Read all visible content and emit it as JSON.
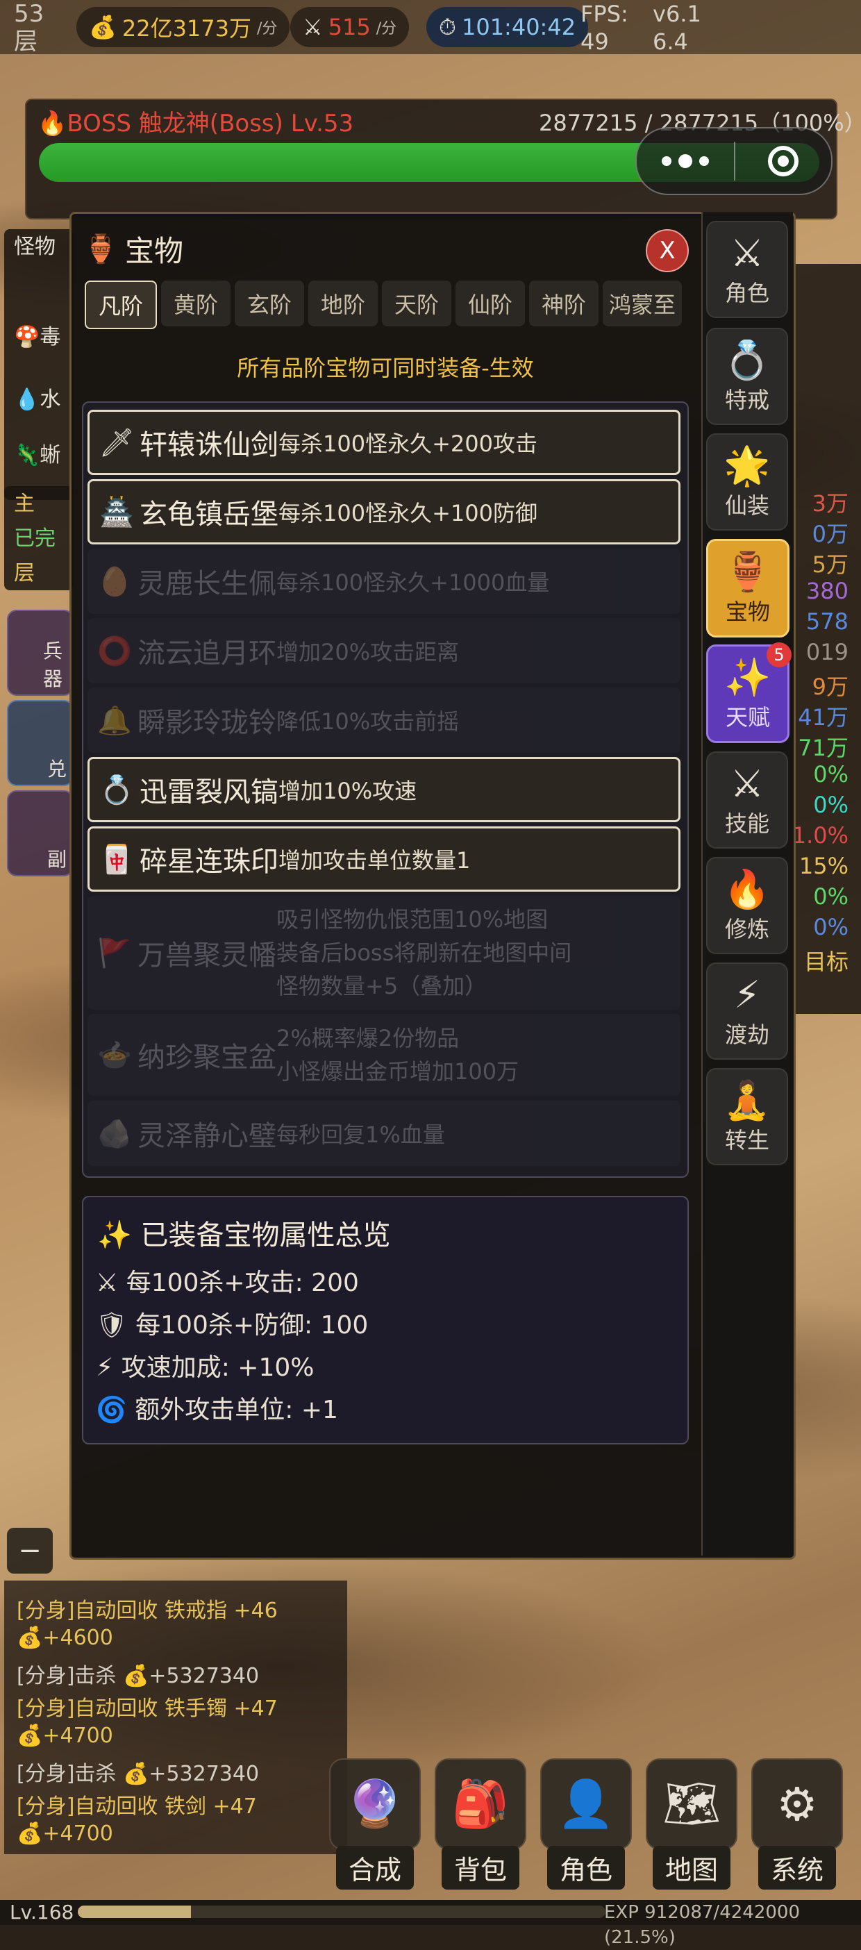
{
  "topbar": {
    "floor": "53\n层",
    "gold": "22亿3173万",
    "gold_unit": "/分",
    "kills": "515",
    "kills_unit": "/分",
    "timer": "101:40:42",
    "fps": "FPS: 49",
    "version": "v6.16.4"
  },
  "boss": {
    "name": "BOSS 触龙神(Boss) Lv.53",
    "hp": "2877215 / 2877215（100%）",
    "hp_fraction": 1.0
  },
  "left_panel": {
    "title": "怪物",
    "items": [
      "毒",
      "水",
      "蜥"
    ],
    "quest": "主",
    "quest_done": "已完",
    "quest_floor": "层",
    "btn1": "兵器",
    "btn2": "兑",
    "btn3": "副"
  },
  "right_values": [
    "3万",
    "0万",
    "5万",
    "380",
    "578",
    "019",
    "9万",
    "41万",
    "71万",
    "0%",
    "0%",
    "1.0%",
    "15%",
    "0%",
    "0%",
    "目标"
  ],
  "modal": {
    "title": "宝物",
    "close": "X",
    "tabs": [
      "凡阶",
      "黄阶",
      "玄阶",
      "地阶",
      "天阶",
      "仙阶",
      "神阶",
      "鸿蒙至"
    ],
    "active_tab": "凡阶",
    "notice": "所有品阶宝物可同时装备-生效",
    "treasures": [
      {
        "name": "轩辕诛仙剑",
        "desc": "每杀100怪永久+200攻击",
        "equipped": true
      },
      {
        "name": "玄龟镇岳堡",
        "desc": "每杀100怪永久+100防御",
        "equipped": true
      },
      {
        "name": "灵鹿长生佩",
        "desc": "每杀100怪永久+1000血量",
        "equipped": false
      },
      {
        "name": "流云追月环",
        "desc": "增加20%攻击距离",
        "equipped": false
      },
      {
        "name": "瞬影玲珑铃",
        "desc": "降低10%攻击前摇",
        "equipped": false
      },
      {
        "name": "迅雷裂风镐",
        "desc": "增加10%攻速",
        "equipped": true
      },
      {
        "name": "碎星连珠印",
        "desc": "增加攻击单位数量1",
        "equipped": true
      },
      {
        "name": "万兽聚灵幡",
        "desc": "吸引怪物仇恨范围10%地图\n装备后boss将刷新在地图中间\n怪物数量+5（叠加）",
        "equipped": false
      },
      {
        "name": "纳珍聚宝盆",
        "desc": "2%概率爆2份物品\n小怪爆出金币增加100万",
        "equipped": false
      },
      {
        "name": "灵泽静心璧",
        "desc": "每秒回复1%血量",
        "equipped": false
      }
    ],
    "summary": {
      "title": "已装备宝物属性总览",
      "lines": [
        "每100杀+攻击: 200",
        "每100杀+防御: 100",
        "攻速加成: +10%",
        "额外攻击单位: +1"
      ]
    }
  },
  "sidenav": [
    {
      "label": "角色",
      "icon": "⚔"
    },
    {
      "label": "特戒",
      "icon": "💍"
    },
    {
      "label": "仙装",
      "icon": "🌟"
    },
    {
      "label": "宝物",
      "icon": "🏺"
    },
    {
      "label": "天赋",
      "icon": "✨",
      "badge": "5"
    },
    {
      "label": "技能",
      "icon": "⚔"
    },
    {
      "label": "修炼",
      "icon": "🔥"
    },
    {
      "label": "渡劫",
      "icon": "⚡"
    },
    {
      "label": "转生",
      "icon": "🧘"
    }
  ],
  "log": [
    {
      "text": "[分身]自动回收 铁戒指 +46",
      "style": "y"
    },
    {
      "text": "💰+4600",
      "style": "y"
    },
    {
      "text": "[分身]击杀 💰+5327340",
      "style": "g"
    },
    {
      "text": "[分身]自动回收 铁手镯 +47",
      "style": "y"
    },
    {
      "text": "💰+4700",
      "style": "y"
    },
    {
      "text": "[分身]击杀 💰+5327340",
      "style": "g"
    },
    {
      "text": "[分身]自动回收 铁剑 +47",
      "style": "y"
    },
    {
      "text": "💰+4700",
      "style": "y"
    }
  ],
  "minus_label": "−",
  "bottomnav": [
    {
      "label": "合成",
      "icon": "🔮"
    },
    {
      "label": "背包",
      "icon": "🎒"
    },
    {
      "label": "角色",
      "icon": "👤"
    },
    {
      "label": "地图",
      "icon": "🗺"
    },
    {
      "label": "系统",
      "icon": "⚙"
    }
  ],
  "exp": {
    "level": "Lv.168",
    "text": "EXP 912087/4242000 (21.5%)",
    "fraction": 0.215
  },
  "colors": {
    "accent_gold": "#f0c24a",
    "boss_red": "#e24a3a",
    "hp_green": "#3db43d",
    "active_nav": "#e0a02c",
    "talent_purple": "#5e3ab8"
  }
}
